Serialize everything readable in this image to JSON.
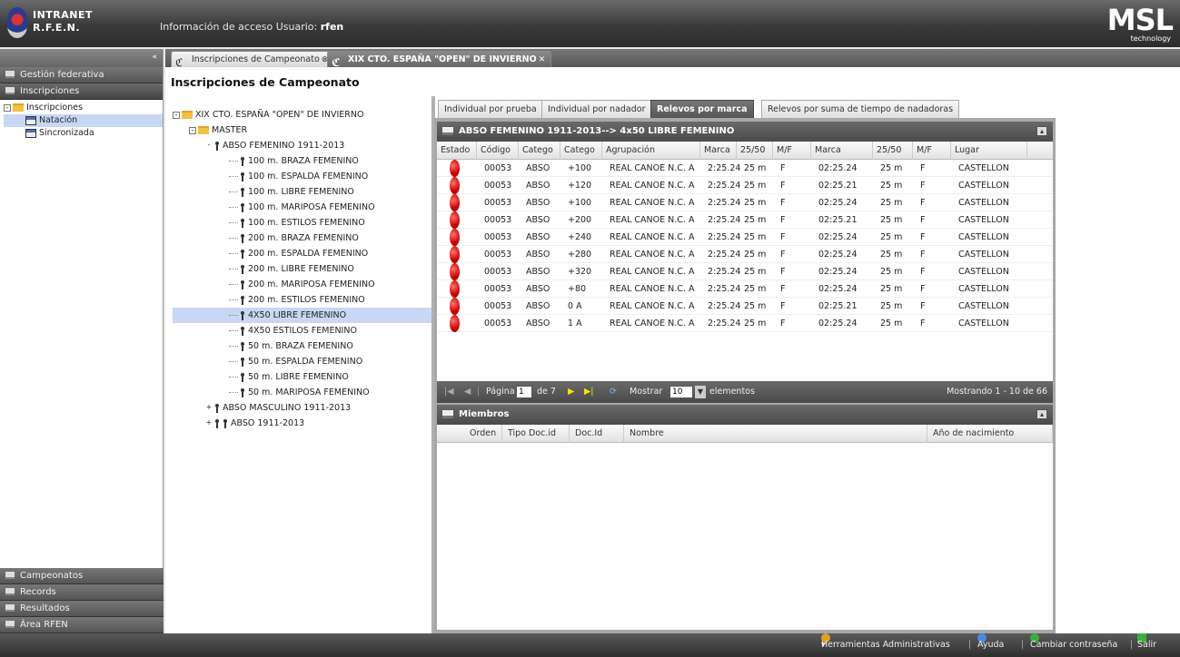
{
  "header": {
    "brand_line1": "INTRANET",
    "brand_line2": "R.F.E.N.",
    "user_info_prefix": "Información de acceso Usuario:",
    "user_name": "rfen",
    "logo_text": "MSL",
    "logo_subtext": "technology"
  },
  "sidebar": {
    "top_sections": [
      {
        "label": "Gestión federativa"
      },
      {
        "label": "Inscripciones"
      }
    ],
    "tree": {
      "root": "Inscripciones",
      "children": [
        "Natación",
        "Sincronizada"
      ]
    },
    "bottom_sections": [
      {
        "label": "Campeonatos"
      },
      {
        "label": "Records"
      },
      {
        "label": "Resultados"
      },
      {
        "label": "Área RFEN"
      }
    ]
  },
  "tabs": [
    {
      "label": "Inscripciones de Campeonato"
    },
    {
      "label": "XIX CTO. ESPAÑA \"OPEN\" DE INVIERNO"
    }
  ],
  "page_title": "Inscripciones de Campeonato",
  "event_tree": {
    "root": "XIX CTO. ESPAÑA \"OPEN\" DE INVIERNO",
    "group": "MASTER",
    "category_open": "ABSO FEMENINO 1911-2013",
    "events": [
      "100 m. BRAZA FEMENINO",
      "100 m. ESPALDA FEMENINO",
      "100 m. LIBRE FEMENINO",
      "100 m. MARIPOSA FEMENINO",
      "100 m. ESTILOS FEMENINO",
      "200 m. BRAZA FEMENINO",
      "200 m. ESPALDA FEMENINO",
      "200 m. LIBRE FEMENINO",
      "200 m. MARIPOSA FEMENINO",
      "200 m. ESTILOS FEMENINO",
      "4X50 LIBRE FEMENINO",
      "4X50 ESTILOS FEMENINO",
      "50 m. BRAZA FEMENINO",
      "50 m. ESPALDA FEMENINO",
      "50 m. LIBRE FEMENINO",
      "50 m. MARIPOSA FEMENINO"
    ],
    "category_male": "ABSO MASCULINO 1911-2013",
    "category_mixed": "ABSO 1911-2013"
  },
  "sub_tabs": [
    {
      "label": "Individual por prueba"
    },
    {
      "label": "Individual por nadador"
    },
    {
      "label": "Relevos por marca"
    },
    {
      "label": "Relevos por suma de tiempo de nadadoras"
    }
  ],
  "grid": {
    "title": "ABSO FEMENINO 1911-2013--> 4x50 LIBRE FEMENINO",
    "columns": [
      "Estado",
      "Código",
      "Catego",
      "Catego",
      "Agrupación",
      "Marca",
      "25/50",
      "M/F",
      "Marca",
      "25/50",
      "M/F",
      "Lugar"
    ],
    "rows": [
      [
        "00053",
        "ABSO",
        "+100",
        "REAL CANOE N.C. A",
        "2:25.24",
        "25 m",
        "F",
        "02:25.24",
        "25 m",
        "F",
        "CASTELLON"
      ],
      [
        "00053",
        "ABSO",
        "+120",
        "REAL CANOE N.C. A",
        "2:25.24",
        "25 m",
        "F",
        "02:25.21",
        "25 m",
        "F",
        "CASTELLON"
      ],
      [
        "00053",
        "ABSO",
        "+100",
        "REAL CANOE N.C. A",
        "2:25.24",
        "25 m",
        "F",
        "02:25.24",
        "25 m",
        "F",
        "CASTELLON"
      ],
      [
        "00053",
        "ABSO",
        "+200",
        "REAL CANOE N.C. A",
        "2:25.24",
        "25 m",
        "F",
        "02:25.21",
        "25 m",
        "F",
        "CASTELLON"
      ],
      [
        "00053",
        "ABSO",
        "+240",
        "REAL CANOE N.C. A",
        "2:25.24",
        "25 m",
        "F",
        "02:25.24",
        "25 m",
        "F",
        "CASTELLON"
      ],
      [
        "00053",
        "ABSO",
        "+280",
        "REAL CANOE N.C. A",
        "2:25.24",
        "25 m",
        "F",
        "02:25.24",
        "25 m",
        "F",
        "CASTELLON"
      ],
      [
        "00053",
        "ABSO",
        "+320",
        "REAL CANOE N.C. A",
        "2:25.24",
        "25 m",
        "F",
        "02:25.24",
        "25 m",
        "F",
        "CASTELLON"
      ],
      [
        "00053",
        "ABSO",
        "+80",
        "REAL CANOE N.C. A",
        "2:25.24",
        "25 m",
        "F",
        "02:25.24",
        "25 m",
        "F",
        "CASTELLON"
      ],
      [
        "00053",
        "ABSO",
        "0 A",
        "REAL CANOE N.C. A",
        "2:25.24",
        "25 m",
        "F",
        "02:25.21",
        "25 m",
        "F",
        "CASTELLON"
      ],
      [
        "00053",
        "ABSO",
        "1 A",
        "REAL CANOE N.C. A",
        "2:25.24",
        "25 m",
        "F",
        "02:25.24",
        "25 m",
        "F",
        "CASTELLON"
      ]
    ],
    "status_color": "#d10000"
  },
  "pager": {
    "page_label": "Página",
    "page_value": "1",
    "of_label": "de 7",
    "show_label": "Mostrar",
    "show_value": "10",
    "elements_label": "elementos",
    "summary": "Mostrando 1 - 10 de 66"
  },
  "members": {
    "title": "Miembros",
    "columns": [
      "Orden",
      "Tipo Doc.id",
      "Doc.Id",
      "Nombre",
      "Año de nacimiento"
    ]
  },
  "statusbar": {
    "tools": "Herramientas Administrativas",
    "help": "Ayuda",
    "change_password": "Cambiar contraseña",
    "exit": "Salir"
  }
}
